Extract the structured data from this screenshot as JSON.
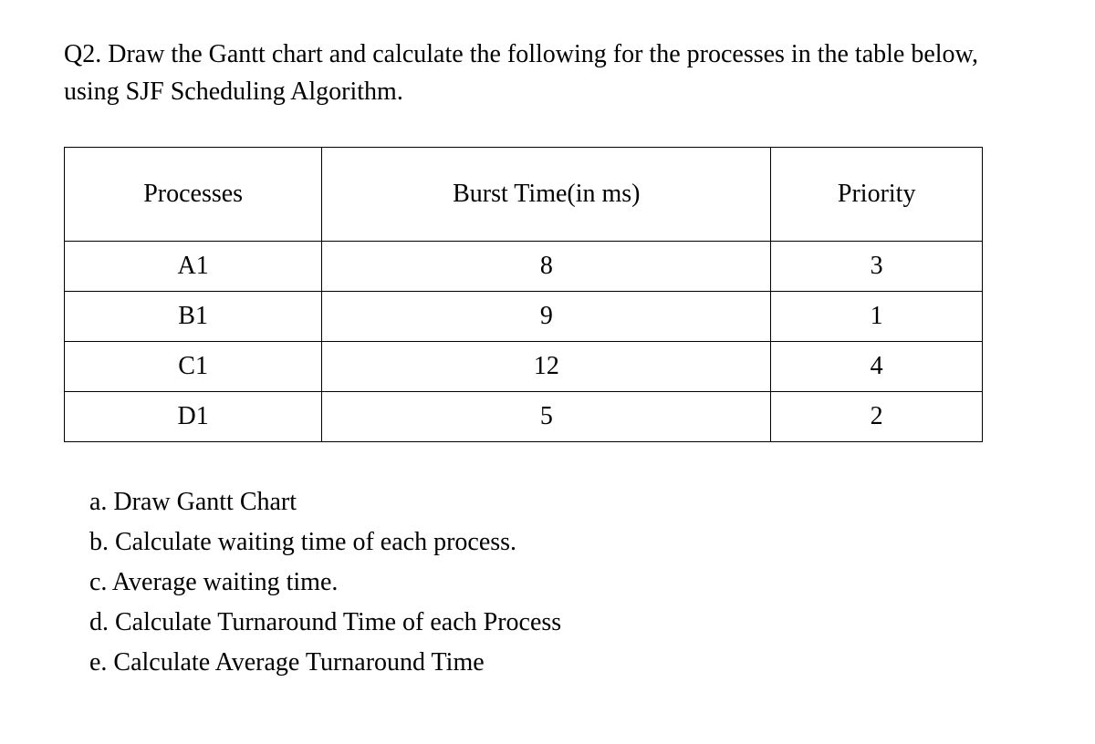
{
  "question": {
    "prompt": "Q2. Draw the Gantt chart and calculate the following for the processes in the table below, using SJF Scheduling Algorithm."
  },
  "table": {
    "headers": {
      "col0": "Processes",
      "col1": "Burst Time(in ms)",
      "col2": "Priority"
    },
    "rows": [
      {
        "process": "A1",
        "burst": "8",
        "priority": "3"
      },
      {
        "process": "B1",
        "burst": "9",
        "priority": "1"
      },
      {
        "process": "C1",
        "burst": "12",
        "priority": "4"
      },
      {
        "process": "D1",
        "burst": "5",
        "priority": "2"
      }
    ]
  },
  "subparts": {
    "a": "a. Draw Gantt Chart",
    "b": "b. Calculate waiting time of each process.",
    "c": "c. Average waiting time.",
    "d": "d. Calculate Turnaround Time of each Process",
    "e": "e. Calculate Average Turnaround Time"
  }
}
